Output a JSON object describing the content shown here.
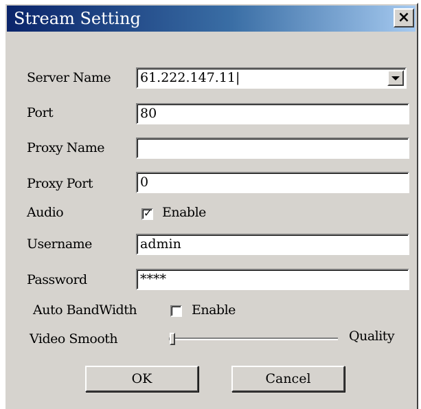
{
  "window": {
    "title": "Stream Setting",
    "close_glyph": "×"
  },
  "fields": {
    "server_name": {
      "label": "Server Name",
      "value": "61.222.147.11|"
    },
    "port": {
      "label": "Port",
      "value": "80"
    },
    "proxy_name": {
      "label": "Proxy Name",
      "value": ""
    },
    "proxy_port": {
      "label": "Proxy Port",
      "value": "0"
    },
    "audio": {
      "label": "Audio",
      "checkbox_label": "Enable",
      "checked": true,
      "check_glyph": "✓"
    },
    "username": {
      "label": "Username",
      "value": "admin"
    },
    "password": {
      "label": "Password",
      "value": "****"
    },
    "auto_bandwidth": {
      "label": "Auto BandWidth",
      "checkbox_label": "Enable",
      "checked": false
    },
    "video_smooth": {
      "label": "Video Smooth",
      "end_label": "Quality",
      "level": 0.0
    }
  },
  "buttons": {
    "ok": "OK",
    "cancel": "Cancel"
  }
}
